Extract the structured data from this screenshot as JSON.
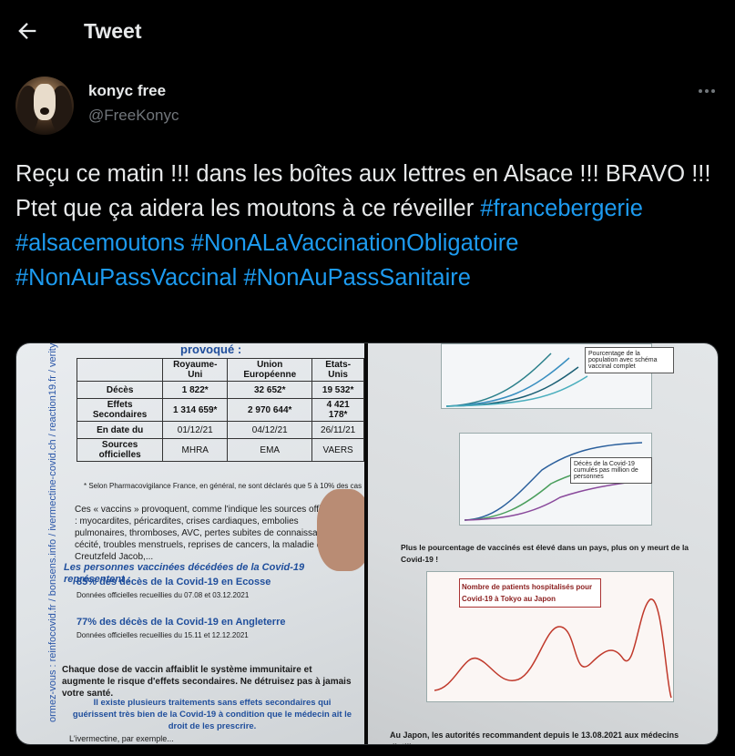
{
  "header": {
    "title": "Tweet"
  },
  "author": {
    "display_name": "konyc free",
    "handle": "@FreeKonyc"
  },
  "tweet": {
    "text_parts": [
      {
        "t": "Reçu ce matin !!! dans les boîtes aux lettres en Alsace !!! BRAVO !!! Ptet que ça aidera les moutons à ce réveiller ",
        "tag": false
      },
      {
        "t": "#francebergerie",
        "tag": true
      },
      {
        "t": " ",
        "tag": false
      },
      {
        "t": "#alsacemoutons",
        "tag": true
      },
      {
        "t": " ",
        "tag": false
      },
      {
        "t": "#NonALaVaccinationObligatoire",
        "tag": true
      },
      {
        "t": " ",
        "tag": false
      },
      {
        "t": "#NonAuPassVaccinal",
        "tag": true
      },
      {
        "t": " ",
        "tag": false
      },
      {
        "t": "#NonAuPassSanitaire",
        "tag": true
      }
    ]
  },
  "photo_left": {
    "side_url": "ormez-vous : reinfocovid.fr / bonsens.info / ivermectine-covid.ch / reaction19.fr / verity-france.org",
    "heading": "provoqué :",
    "table_header": [
      "",
      "Royaume-Uni",
      "Union Européenne",
      "Etats-Unis"
    ],
    "table_rows": [
      [
        "Décès",
        "1 822*",
        "32 652*",
        "19 532*"
      ],
      [
        "Effets Secondaires",
        "1 314 659*",
        "2 970 644*",
        "4 421 178*"
      ],
      [
        "En date du",
        "01/12/21",
        "04/12/21",
        "26/11/21"
      ],
      [
        "Sources officielles",
        "MHRA",
        "EMA",
        "VAERS"
      ]
    ],
    "footnote": "* Selon Pharmacovigilance France, en général, ne sont déclarés que 5 à 10% des cas",
    "p1": "Ces « vaccins » provoquent, comme l'indique les sources officielles : myocardites, péricardites, crises cardiaques, embolies pulmonaires, thromboses, AVC, pertes subites de connaissance, cécité, troubles menstruels, reprises de cancers, la maladie de Creutzfeld Jacob,...",
    "blue_heading": "Les personnes vaccinées décédées de la Covid-19 représentent :",
    "b1": "85% des décès de la Covid-19 en Ecosse",
    "b1_detail": "Données officielles recueillies du 07.08 et 03.12.2021",
    "b2": "77% des décès de la Covid-19 en Angleterre",
    "b2_detail": "Données officielles recueillies du 15.11 et 12.12.2021",
    "p2": "Chaque dose de vaccin affaiblit le système immunitaire et augmente le risque d'effets secondaires. Ne détruisez pas à jamais votre santé.",
    "p3": "Il existe plusieurs traitements sans effets secondaires qui guérissent très bien de la Covid-19 à condition que le médecin ait le droit de les prescrire.",
    "p4": "L'ivermectine, par exemple..."
  },
  "photo_right": {
    "legend1": "Pourcentage de la population avec schéma vaccinal complet",
    "legend2": "Décès de la Covid-19 cumulés pas million de personnes",
    "mid_text": "Plus le pourcentage de vaccinés est élevé dans un pays, plus on y meurt de la Covid-19 !",
    "chart_title": "Nombre de patients hospitalisés pour Covid-19 à Tokyo au Japon",
    "bottom_text": "Au Japon, les autorités recommandent depuis le 13.08.2021 aux médecins d'utiliser"
  }
}
